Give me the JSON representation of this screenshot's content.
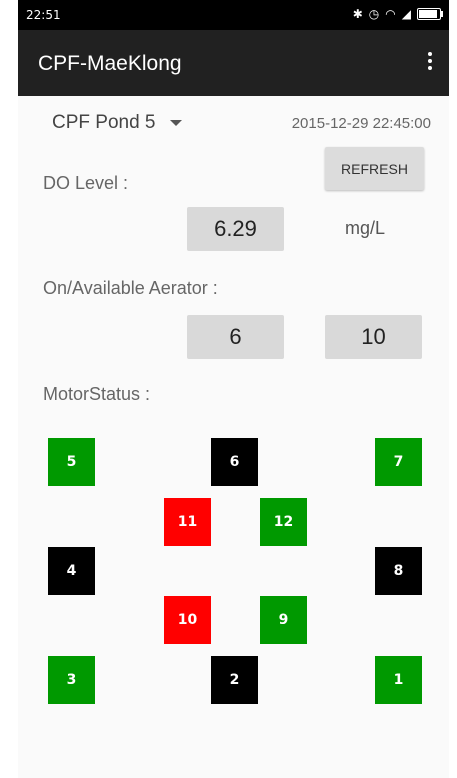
{
  "status_bar": {
    "time": "22:51",
    "icons": [
      "bluetooth-icon",
      "alarm-icon",
      "wifi-icon",
      "signal-icon",
      "battery-icon"
    ]
  },
  "app_bar": {
    "title": "CPF-MaeKlong",
    "menu_icon": "overflow-menu-icon"
  },
  "pond": {
    "selected": "CPF Pond 5",
    "datetime": "2015-12-29 22:45:00"
  },
  "refresh_label": "REFRESH",
  "do": {
    "label": "DO Level :",
    "value": "6.29",
    "unit": "mg/L"
  },
  "aerator": {
    "label": "On/Available Aerator :",
    "on": "6",
    "available": "10"
  },
  "motor": {
    "label": "MotorStatus :",
    "colors": {
      "green": "#009900",
      "red": "#ff0000",
      "black": "#000000"
    },
    "items": [
      {
        "number": "5",
        "status": "green"
      },
      {
        "number": "6",
        "status": "black"
      },
      {
        "number": "7",
        "status": "green"
      },
      {
        "number": "11",
        "status": "red"
      },
      {
        "number": "12",
        "status": "green"
      },
      {
        "number": "4",
        "status": "black"
      },
      {
        "number": "8",
        "status": "black"
      },
      {
        "number": "10",
        "status": "red"
      },
      {
        "number": "9",
        "status": "green"
      },
      {
        "number": "3",
        "status": "green"
      },
      {
        "number": "2",
        "status": "black"
      },
      {
        "number": "1",
        "status": "green"
      }
    ]
  }
}
